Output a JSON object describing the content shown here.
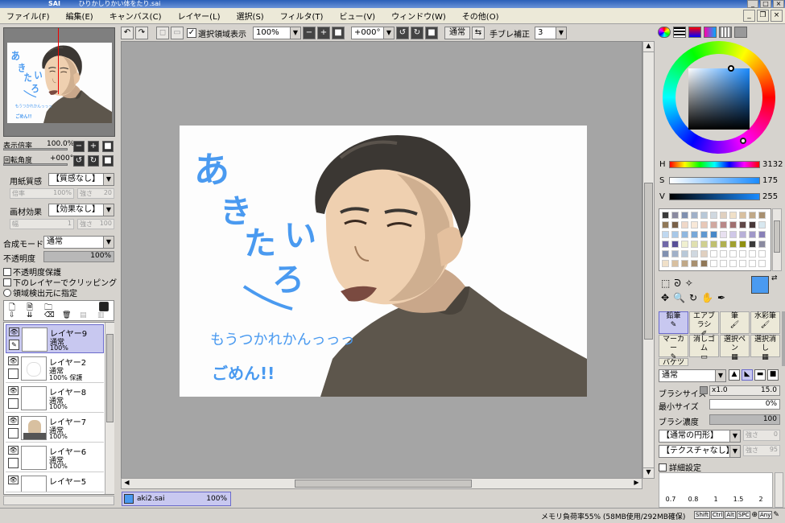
{
  "window": {
    "title": "ひりかしりかい体をたり.sai",
    "brand": "SAI"
  },
  "menu": [
    "ファイル(F)",
    "編集(E)",
    "キャンバス(C)",
    "レイヤー(L)",
    "選択(S)",
    "フィルタ(T)",
    "ビュー(V)",
    "ウィンドウ(W)",
    "その他(O)"
  ],
  "toolbar": {
    "selection_label": "選択領域表示",
    "zoom": "100%",
    "rotation": "+000°",
    "mode": "通常",
    "stabilizer_label": "手ブレ補正",
    "stabilizer_value": "3"
  },
  "left": {
    "zoom_label": "表示倍率",
    "zoom_value": "100.0%",
    "rotate_label": "回転角度",
    "rotate_value": "+000°",
    "paper_label": "用紙質感",
    "paper_value": "【質感なし】",
    "paper_scale_label": "倍率",
    "paper_scale_value": "100%",
    "paper_strength_label": "強さ",
    "paper_strength_value": "20",
    "effect_label": "画材効果",
    "effect_value": "【効果なし】",
    "effect_width_label": "幅",
    "effect_width_value": "1",
    "effect_strength_label": "強さ",
    "effect_strength_value": "100",
    "blend_label": "合成モード",
    "blend_value": "通常",
    "opacity_label": "不透明度",
    "opacity_value": "100%",
    "opt1": "不透明度保護",
    "opt2": "下のレイヤーでクリッピング",
    "opt3": "領域検出元に指定"
  },
  "layers": [
    {
      "name": "レイヤー9",
      "mode": "通常",
      "opacity": "100%"
    },
    {
      "name": "レイヤー2",
      "mode": "通常",
      "opacity": "100% 保護"
    },
    {
      "name": "レイヤー8",
      "mode": "通常",
      "opacity": "100%"
    },
    {
      "name": "レイヤー7",
      "mode": "通常",
      "opacity": "100%"
    },
    {
      "name": "レイヤー6",
      "mode": "通常",
      "opacity": "100%"
    },
    {
      "name": "レイヤー5",
      "mode": "",
      "opacity": ""
    }
  ],
  "canvas": {
    "text1": "あきたいろ",
    "text2": "もうつかれかんっっっ",
    "text3": "ごめん!!"
  },
  "doctab": {
    "name": "aki2.sai",
    "zoom": "100%"
  },
  "color": {
    "h_label": "H",
    "h_value": "3132",
    "s_label": "S",
    "s_value": "175",
    "v_label": "V",
    "v_value": "255",
    "current": "#4a9af0"
  },
  "tools": [
    "鉛筆",
    "エアブラシ",
    "筆",
    "水彩筆",
    "マーカー",
    "消しゴム",
    "選択ペン",
    "選択消し",
    "バケツ"
  ],
  "brush": {
    "mode": "通常",
    "size_label": "ブラシサイズ",
    "size_mult": "x1.0",
    "size_value": "15.0",
    "min_label": "最小サイズ",
    "min_value": "0%",
    "density_label": "ブラシ濃度",
    "density_value": "100",
    "shape_value": "【通常の円形】",
    "shape_strength_label": "強さ",
    "shape_strength_value": "0",
    "texture_value": "【テクスチャなし】",
    "texture_strength_label": "強さ",
    "texture_strength_value": "95",
    "detail_label": "詳細設定",
    "sizes": [
      "0.7",
      "0.8",
      "1",
      "1.5",
      "2"
    ]
  },
  "status": {
    "memory": "メモリ負荷率55% (58MB使用/292MB確保)",
    "keys": [
      "Shift",
      "Ctrl",
      "Alt",
      "SPC",
      "Any"
    ]
  }
}
